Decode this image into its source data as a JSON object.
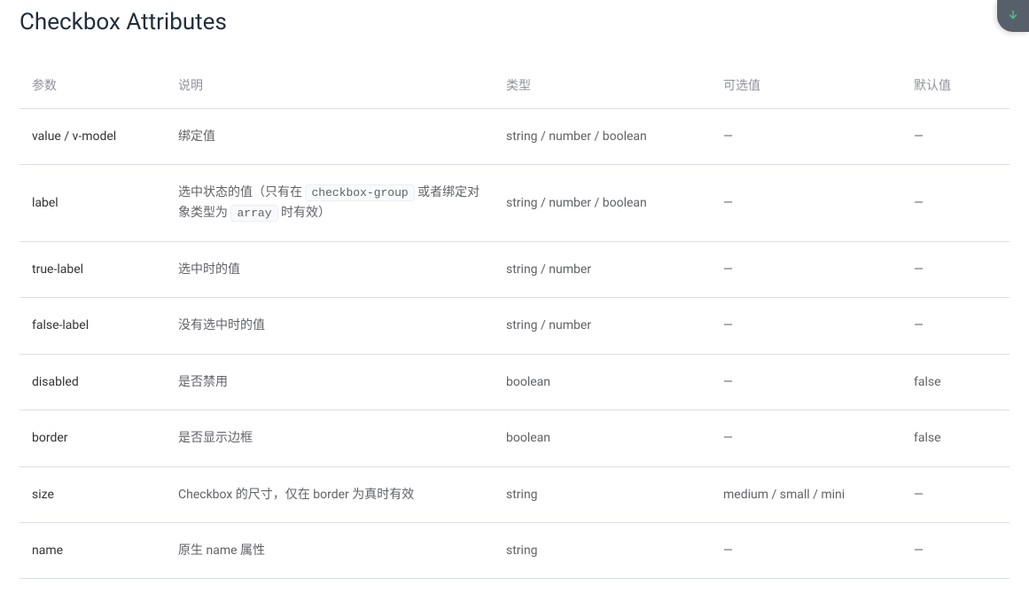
{
  "title": "Checkbox Attributes",
  "headers": {
    "param": "参数",
    "desc": "说明",
    "type": "类型",
    "accepted": "可选值",
    "default": "默认值"
  },
  "rows": [
    {
      "param": "value / v-model",
      "desc_parts": [
        {
          "t": "text",
          "v": "绑定值"
        }
      ],
      "type": "string / number / boolean",
      "accepted": "—",
      "default": "—"
    },
    {
      "param": "label",
      "desc_parts": [
        {
          "t": "text",
          "v": "选中状态的值（只有在 "
        },
        {
          "t": "code",
          "v": "checkbox-group"
        },
        {
          "t": "text",
          "v": " 或者绑定对象类型为 "
        },
        {
          "t": "code",
          "v": "array"
        },
        {
          "t": "text",
          "v": " 时有效）"
        }
      ],
      "type": "string / number / boolean",
      "accepted": "—",
      "default": "—"
    },
    {
      "param": "true-label",
      "desc_parts": [
        {
          "t": "text",
          "v": "选中时的值"
        }
      ],
      "type": "string / number",
      "accepted": "—",
      "default": "—"
    },
    {
      "param": "false-label",
      "desc_parts": [
        {
          "t": "text",
          "v": "没有选中时的值"
        }
      ],
      "type": "string / number",
      "accepted": "—",
      "default": "—"
    },
    {
      "param": "disabled",
      "desc_parts": [
        {
          "t": "text",
          "v": "是否禁用"
        }
      ],
      "type": "boolean",
      "accepted": "—",
      "default": "false"
    },
    {
      "param": "border",
      "desc_parts": [
        {
          "t": "text",
          "v": "是否显示边框"
        }
      ],
      "type": "boolean",
      "accepted": "—",
      "default": "false"
    },
    {
      "param": "size",
      "desc_parts": [
        {
          "t": "text",
          "v": "Checkbox 的尺寸，仅在 border 为真时有效"
        }
      ],
      "type": "string",
      "accepted": "medium / small / mini",
      "default": "—"
    },
    {
      "param": "name",
      "desc_parts": [
        {
          "t": "text",
          "v": "原生 name 属性"
        }
      ],
      "type": "string",
      "accepted": "—",
      "default": "—"
    }
  ]
}
